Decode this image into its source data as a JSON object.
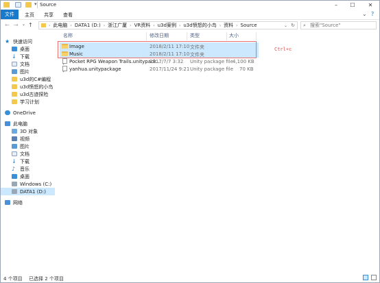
{
  "window": {
    "title": "Source",
    "controls": [
      "minimize",
      "maximize",
      "close"
    ]
  },
  "ribbon": {
    "tabs": [
      "文件",
      "主页",
      "共享",
      "查看"
    ],
    "help": "?"
  },
  "address": {
    "breadcrumbs": [
      "此电脑",
      "DATA1 (D:)",
      "浙江广厦",
      "VR资料",
      "u3d案例",
      "u3d愤怒的小鸟",
      "资料",
      "Source"
    ],
    "search_placeholder": "搜索\"Source\""
  },
  "navpane": {
    "quick_access": "快速访问",
    "quick_items": [
      "桌面",
      "下载",
      "文档",
      "图片",
      "u3d的C#编程",
      "u3d愤怒的小鸟",
      "u3d古迹探险",
      "学习计划"
    ],
    "onedrive": "OneDrive",
    "this_pc": "此电脑",
    "pc_items": [
      "3D 对象",
      "视频",
      "图片",
      "文档",
      "下载",
      "音乐",
      "桌面",
      "Windows (C:)",
      "DATA1 (D:)"
    ],
    "network": "网络"
  },
  "columns": {
    "name": "名称",
    "date": "修改日期",
    "type": "类型",
    "size": "大小"
  },
  "files": [
    {
      "name": "Image",
      "date": "2018/2/11 17:10",
      "type": "文件夹",
      "size": "",
      "kind": "folder"
    },
    {
      "name": "Music",
      "date": "2018/2/11 17:10",
      "type": "文件夹",
      "size": "",
      "kind": "folder"
    },
    {
      "name": "Pocket RPG Weapon Trails.unitypack...",
      "date": "2017/7/7 3:32",
      "type": "Unity package file",
      "size": "4,100 KB",
      "kind": "file"
    },
    {
      "name": "yanhua.unitypackage",
      "date": "2017/11/24 9:21",
      "type": "Unity package file",
      "size": "70 KB",
      "kind": "file"
    }
  ],
  "annotation": "Ctrl+c",
  "status": {
    "count": "4 个项目",
    "selected": "已选择 2 个项目"
  },
  "colors": {
    "accent": "#1979ca",
    "selection": "#cce8ff",
    "folder": "#f7d06a",
    "highlight_box": "#e87070"
  }
}
